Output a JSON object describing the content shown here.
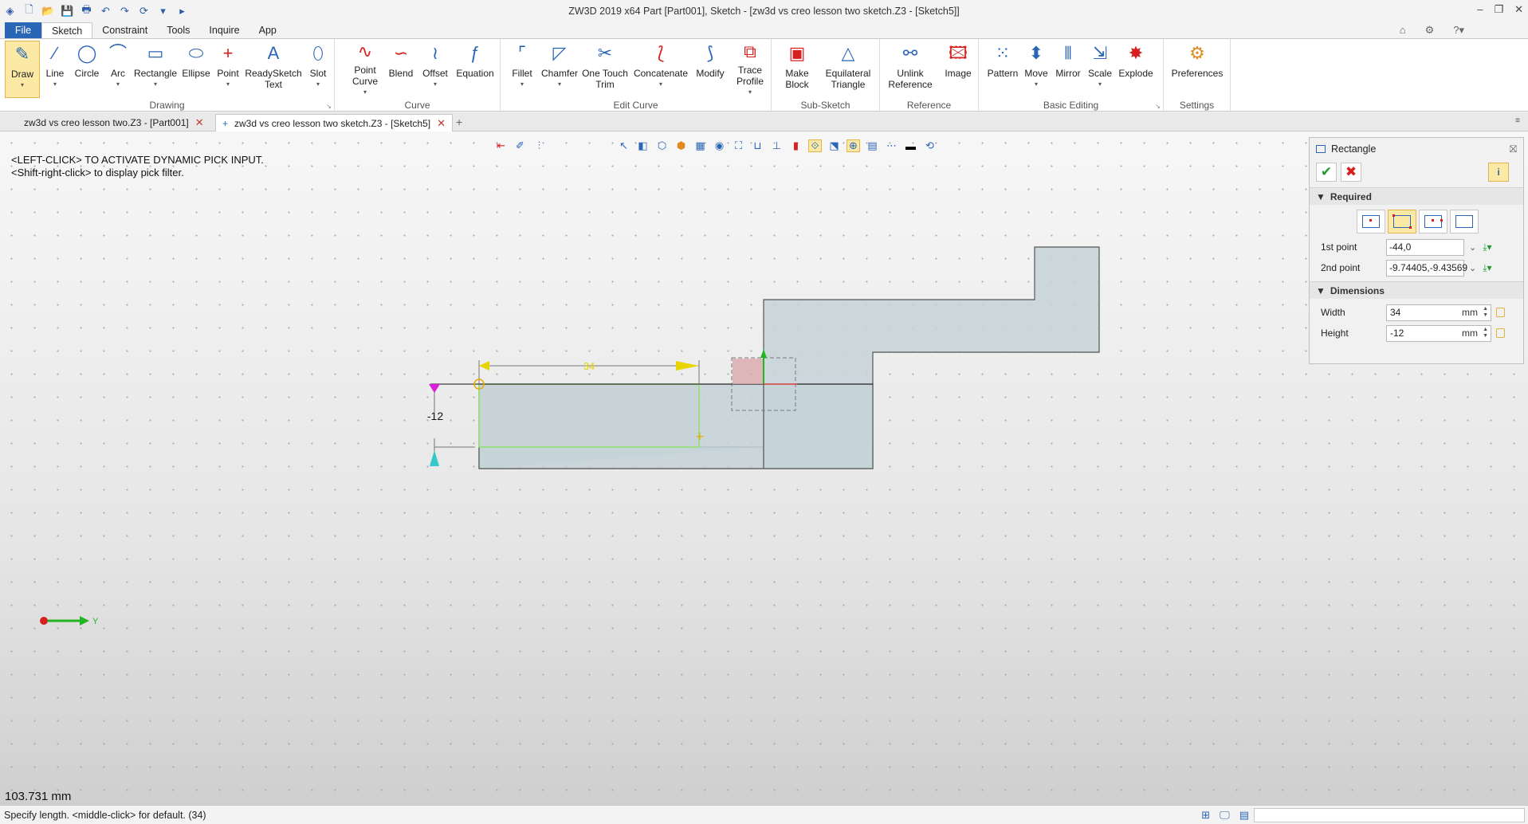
{
  "window": {
    "title": "ZW3D 2019  x64          Part [Part001],  Sketch - [zw3d vs creo lesson two sketch.Z3 - [Sketch5]]"
  },
  "menu": {
    "tabs": [
      "File",
      "Sketch",
      "Constraint",
      "Tools",
      "Inquire",
      "App"
    ],
    "active": "Sketch"
  },
  "ribbon": {
    "groups": [
      {
        "label": "Drawing",
        "buttons": [
          {
            "label": "Draw",
            "icon": "pencil-icon"
          },
          {
            "label": "Line",
            "icon": "line-icon"
          },
          {
            "label": "Circle",
            "icon": "circle-icon"
          },
          {
            "label": "Arc",
            "icon": "arc-icon"
          },
          {
            "label": "Rectangle",
            "icon": "rectangle-icon"
          },
          {
            "label": "Ellipse",
            "icon": "ellipse-icon"
          },
          {
            "label": "Point",
            "icon": "point-icon"
          },
          {
            "label": "ReadySketch Text",
            "icon": "text-icon"
          },
          {
            "label": "Slot",
            "icon": "slot-icon"
          }
        ]
      },
      {
        "label": "Curve",
        "buttons": [
          {
            "label": "Point Curve",
            "icon": "point-curve-icon"
          },
          {
            "label": "Blend",
            "icon": "blend-icon"
          },
          {
            "label": "Offset",
            "icon": "offset-icon"
          },
          {
            "label": "Equation",
            "icon": "equation-icon"
          }
        ]
      },
      {
        "label": "Edit Curve",
        "buttons": [
          {
            "label": "Fillet",
            "icon": "fillet-icon"
          },
          {
            "label": "Chamfer",
            "icon": "chamfer-icon"
          },
          {
            "label": "One Touch Trim",
            "icon": "trim-icon"
          },
          {
            "label": "Concatenate",
            "icon": "concatenate-icon"
          },
          {
            "label": "Modify",
            "icon": "modify-icon"
          },
          {
            "label": "Trace Profile",
            "icon": "trace-profile-icon"
          }
        ]
      },
      {
        "label": "Sub-Sketch",
        "buttons": [
          {
            "label": "Make Block",
            "icon": "make-block-icon"
          },
          {
            "label": "Equilateral Triangle",
            "icon": "triangle-icon"
          }
        ]
      },
      {
        "label": "Reference",
        "buttons": [
          {
            "label": "Unlink Reference",
            "icon": "unlink-reference-icon"
          },
          {
            "label": "Image",
            "icon": "image-icon"
          }
        ]
      },
      {
        "label": "Basic Editing",
        "buttons": [
          {
            "label": "Pattern",
            "icon": "pattern-icon"
          },
          {
            "label": "Move",
            "icon": "move-icon"
          },
          {
            "label": "Mirror",
            "icon": "mirror-icon"
          },
          {
            "label": "Scale",
            "icon": "scale-icon"
          },
          {
            "label": "Explode",
            "icon": "explode-icon"
          }
        ]
      },
      {
        "label": "Settings",
        "buttons": [
          {
            "label": "Preferences",
            "icon": "preferences-icon"
          }
        ]
      }
    ]
  },
  "doc_tabs": [
    {
      "label": "zw3d vs creo lesson two.Z3 - [Part001]"
    },
    {
      "label": "zw3d vs creo lesson two sketch.Z3 - [Sketch5]"
    }
  ],
  "canvas": {
    "hint_line1": "<LEFT-CLICK> TO ACTIVATE DYNAMIC PICK INPUT.",
    "hint_line2": "<Shift-right-click> to display pick filter.",
    "dim_width": "34",
    "dim_height": "-12",
    "axis_label": "Y",
    "distance_readout": "103.731 mm"
  },
  "panel": {
    "title": "Rectangle",
    "required_label": "Required",
    "first_point_label": "1st point",
    "first_point_value": "-44,0",
    "second_point_label": "2nd point",
    "second_point_value": "-9.74405,-9.43569",
    "dimensions_label": "Dimensions",
    "width_label": "Width",
    "width_value": "34",
    "width_unit": "mm",
    "height_label": "Height",
    "height_value": "-12",
    "height_unit": "mm"
  },
  "status": {
    "text": "Specify length.  <middle-click> for default. (34)"
  },
  "colors": {
    "accent": "#2a66b6",
    "highlight": "#fde9a6",
    "profile_fill": "#c5d2d8",
    "preview_outline": "#8fe06b",
    "dimension": "#e8d400"
  }
}
